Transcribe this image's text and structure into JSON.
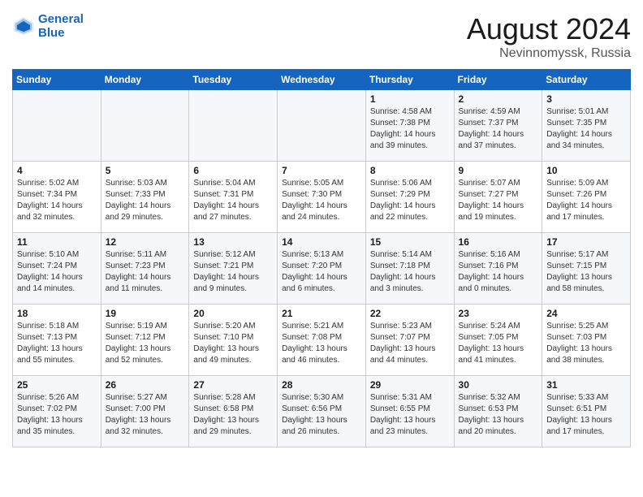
{
  "header": {
    "logo_line1": "General",
    "logo_line2": "Blue",
    "month_year": "August 2024",
    "location": "Nevinnomyssk, Russia"
  },
  "weekdays": [
    "Sunday",
    "Monday",
    "Tuesday",
    "Wednesday",
    "Thursday",
    "Friday",
    "Saturday"
  ],
  "weeks": [
    [
      {
        "day": "",
        "info": ""
      },
      {
        "day": "",
        "info": ""
      },
      {
        "day": "",
        "info": ""
      },
      {
        "day": "",
        "info": ""
      },
      {
        "day": "1",
        "info": "Sunrise: 4:58 AM\nSunset: 7:38 PM\nDaylight: 14 hours\nand 39 minutes."
      },
      {
        "day": "2",
        "info": "Sunrise: 4:59 AM\nSunset: 7:37 PM\nDaylight: 14 hours\nand 37 minutes."
      },
      {
        "day": "3",
        "info": "Sunrise: 5:01 AM\nSunset: 7:35 PM\nDaylight: 14 hours\nand 34 minutes."
      }
    ],
    [
      {
        "day": "4",
        "info": "Sunrise: 5:02 AM\nSunset: 7:34 PM\nDaylight: 14 hours\nand 32 minutes."
      },
      {
        "day": "5",
        "info": "Sunrise: 5:03 AM\nSunset: 7:33 PM\nDaylight: 14 hours\nand 29 minutes."
      },
      {
        "day": "6",
        "info": "Sunrise: 5:04 AM\nSunset: 7:31 PM\nDaylight: 14 hours\nand 27 minutes."
      },
      {
        "day": "7",
        "info": "Sunrise: 5:05 AM\nSunset: 7:30 PM\nDaylight: 14 hours\nand 24 minutes."
      },
      {
        "day": "8",
        "info": "Sunrise: 5:06 AM\nSunset: 7:29 PM\nDaylight: 14 hours\nand 22 minutes."
      },
      {
        "day": "9",
        "info": "Sunrise: 5:07 AM\nSunset: 7:27 PM\nDaylight: 14 hours\nand 19 minutes."
      },
      {
        "day": "10",
        "info": "Sunrise: 5:09 AM\nSunset: 7:26 PM\nDaylight: 14 hours\nand 17 minutes."
      }
    ],
    [
      {
        "day": "11",
        "info": "Sunrise: 5:10 AM\nSunset: 7:24 PM\nDaylight: 14 hours\nand 14 minutes."
      },
      {
        "day": "12",
        "info": "Sunrise: 5:11 AM\nSunset: 7:23 PM\nDaylight: 14 hours\nand 11 minutes."
      },
      {
        "day": "13",
        "info": "Sunrise: 5:12 AM\nSunset: 7:21 PM\nDaylight: 14 hours\nand 9 minutes."
      },
      {
        "day": "14",
        "info": "Sunrise: 5:13 AM\nSunset: 7:20 PM\nDaylight: 14 hours\nand 6 minutes."
      },
      {
        "day": "15",
        "info": "Sunrise: 5:14 AM\nSunset: 7:18 PM\nDaylight: 14 hours\nand 3 minutes."
      },
      {
        "day": "16",
        "info": "Sunrise: 5:16 AM\nSunset: 7:16 PM\nDaylight: 14 hours\nand 0 minutes."
      },
      {
        "day": "17",
        "info": "Sunrise: 5:17 AM\nSunset: 7:15 PM\nDaylight: 13 hours\nand 58 minutes."
      }
    ],
    [
      {
        "day": "18",
        "info": "Sunrise: 5:18 AM\nSunset: 7:13 PM\nDaylight: 13 hours\nand 55 minutes."
      },
      {
        "day": "19",
        "info": "Sunrise: 5:19 AM\nSunset: 7:12 PM\nDaylight: 13 hours\nand 52 minutes."
      },
      {
        "day": "20",
        "info": "Sunrise: 5:20 AM\nSunset: 7:10 PM\nDaylight: 13 hours\nand 49 minutes."
      },
      {
        "day": "21",
        "info": "Sunrise: 5:21 AM\nSunset: 7:08 PM\nDaylight: 13 hours\nand 46 minutes."
      },
      {
        "day": "22",
        "info": "Sunrise: 5:23 AM\nSunset: 7:07 PM\nDaylight: 13 hours\nand 44 minutes."
      },
      {
        "day": "23",
        "info": "Sunrise: 5:24 AM\nSunset: 7:05 PM\nDaylight: 13 hours\nand 41 minutes."
      },
      {
        "day": "24",
        "info": "Sunrise: 5:25 AM\nSunset: 7:03 PM\nDaylight: 13 hours\nand 38 minutes."
      }
    ],
    [
      {
        "day": "25",
        "info": "Sunrise: 5:26 AM\nSunset: 7:02 PM\nDaylight: 13 hours\nand 35 minutes."
      },
      {
        "day": "26",
        "info": "Sunrise: 5:27 AM\nSunset: 7:00 PM\nDaylight: 13 hours\nand 32 minutes."
      },
      {
        "day": "27",
        "info": "Sunrise: 5:28 AM\nSunset: 6:58 PM\nDaylight: 13 hours\nand 29 minutes."
      },
      {
        "day": "28",
        "info": "Sunrise: 5:30 AM\nSunset: 6:56 PM\nDaylight: 13 hours\nand 26 minutes."
      },
      {
        "day": "29",
        "info": "Sunrise: 5:31 AM\nSunset: 6:55 PM\nDaylight: 13 hours\nand 23 minutes."
      },
      {
        "day": "30",
        "info": "Sunrise: 5:32 AM\nSunset: 6:53 PM\nDaylight: 13 hours\nand 20 minutes."
      },
      {
        "day": "31",
        "info": "Sunrise: 5:33 AM\nSunset: 6:51 PM\nDaylight: 13 hours\nand 17 minutes."
      }
    ]
  ]
}
